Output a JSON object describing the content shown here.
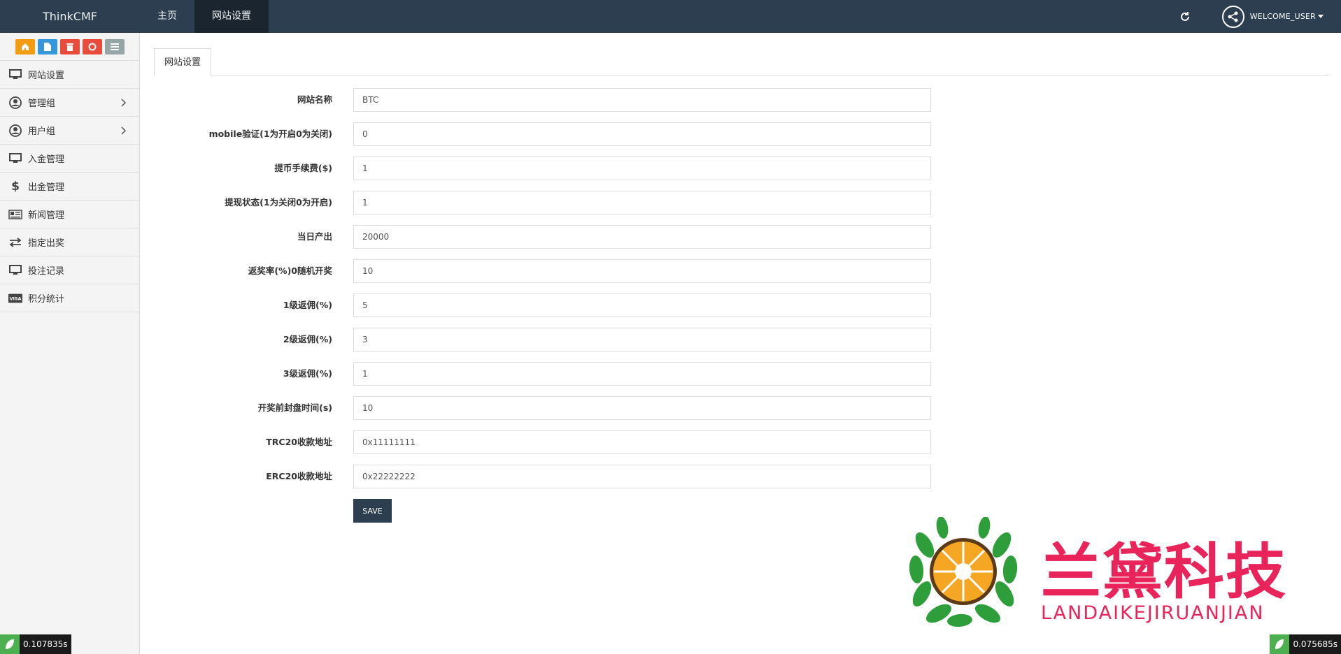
{
  "app": {
    "brand": "ThinkCMF"
  },
  "topnav": [
    {
      "label": "主页",
      "active": false
    },
    {
      "label": "网站设置",
      "active": true
    }
  ],
  "user": {
    "name": "WELCOME_USER"
  },
  "shortcuts": [
    {
      "icon": "home-icon",
      "color": "#f39c12"
    },
    {
      "icon": "file-icon",
      "color": "#3498db"
    },
    {
      "icon": "trash-icon",
      "color": "#e74c3c"
    },
    {
      "icon": "recycle-icon",
      "color": "#e74c3c"
    },
    {
      "icon": "list-icon",
      "color": "#95a5a6"
    }
  ],
  "sidebar": {
    "items": [
      {
        "label": "网站设置",
        "icon": "monitor-icon"
      },
      {
        "label": "管理组",
        "icon": "user-circle-icon",
        "expandable": true
      },
      {
        "label": "用户组",
        "icon": "user-circle-icon",
        "expandable": true
      },
      {
        "label": "入金管理",
        "icon": "monitor-icon"
      },
      {
        "label": "出金管理",
        "icon": "dollar-icon"
      },
      {
        "label": "新闻管理",
        "icon": "newspaper-icon"
      },
      {
        "label": "指定出奖",
        "icon": "exchange-icon"
      },
      {
        "label": "投注记录",
        "icon": "monitor-icon"
      },
      {
        "label": "积分统计",
        "icon": "visa-icon"
      }
    ]
  },
  "main": {
    "tab": "网站设置",
    "fields": [
      {
        "label": "网站名称",
        "value": "BTC"
      },
      {
        "label": "mobile验证(1为开启0为关闭)",
        "value": "0"
      },
      {
        "label": "提币手续费($)",
        "value": "1"
      },
      {
        "label": "提现状态(1为关闭0为开启)",
        "value": "1"
      },
      {
        "label": "当日产出",
        "value": "20000"
      },
      {
        "label": "返奖率(%)0随机开奖",
        "value": "10"
      },
      {
        "label": "1级返佣(%)",
        "value": "5"
      },
      {
        "label": "2级返佣(%)",
        "value": "3"
      },
      {
        "label": "3级返佣(%)",
        "value": "1"
      },
      {
        "label": "开奖前封盘时间(s)",
        "value": "10"
      },
      {
        "label": "TRC20收款地址",
        "value": "0x11111111"
      },
      {
        "label": "ERC20收款地址",
        "value": "0x22222222"
      }
    ],
    "save_label": "SAVE"
  },
  "watermark": {
    "title": "兰黛科技",
    "subtitle": "LANDAIKEJIRUANJIAN"
  },
  "timers": {
    "left": "0.107835s",
    "right": "0.075685s"
  },
  "colors": {
    "topbar": "#2c3e50",
    "accent": "#e8245a",
    "leaf": "#2e9e3a",
    "orange": "#f5a623"
  }
}
